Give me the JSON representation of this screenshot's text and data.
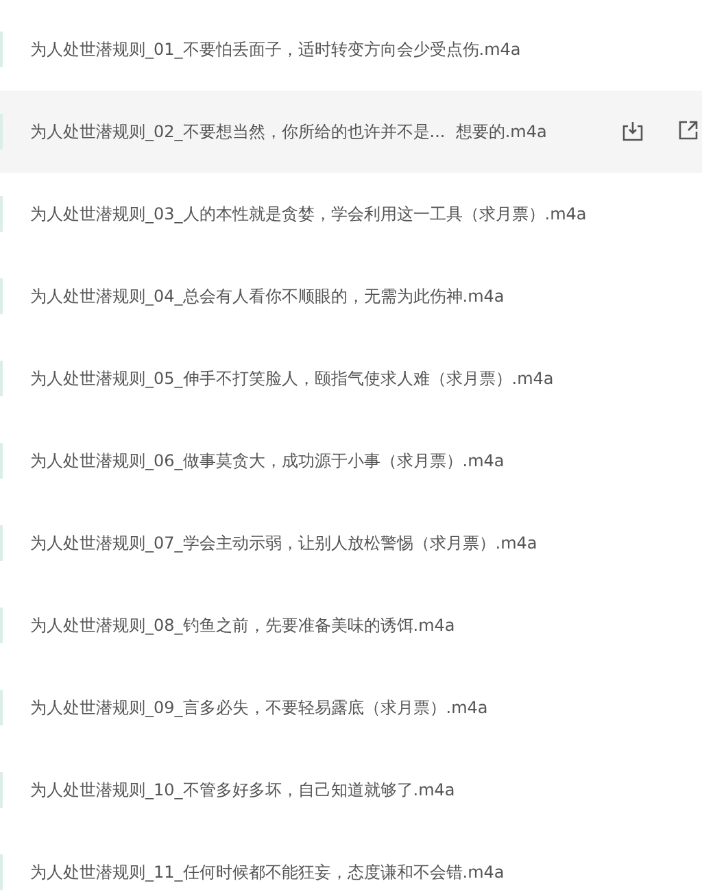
{
  "files": [
    {
      "name": "为人处世潜规则_01_不要怕丢面子，适时转变方向会少受点伤.m4a",
      "highlighted": false
    },
    {
      "name": "为人处世潜规则_02_不要想当然，你所给的也许并不是...  想要的.m4a",
      "highlighted": true
    },
    {
      "name": "为人处世潜规则_03_人的本性就是贪婪，学会利用这一工具（求月票）.m4a",
      "highlighted": false
    },
    {
      "name": "为人处世潜规则_04_总会有人看你不顺眼的，无需为此伤神.m4a",
      "highlighted": false
    },
    {
      "name": "为人处世潜规则_05_伸手不打笑脸人，颐指气使求人难（求月票）.m4a",
      "highlighted": false
    },
    {
      "name": "为人处世潜规则_06_做事莫贪大，成功源于小事（求月票）.m4a",
      "highlighted": false
    },
    {
      "name": "为人处世潜规则_07_学会主动示弱，让别人放松警惕（求月票）.m4a",
      "highlighted": false
    },
    {
      "name": "为人处世潜规则_08_钓鱼之前，先要准备美味的诱饵.m4a",
      "highlighted": false
    },
    {
      "name": "为人处世潜规则_09_言多必失，不要轻易露底（求月票）.m4a",
      "highlighted": false
    },
    {
      "name": "为人处世潜规则_10_不管多好多坏，自己知道就够了.m4a",
      "highlighted": false
    },
    {
      "name": "为人处世潜规则_11_任何时候都不能狂妄，态度谦和不会错.m4a",
      "highlighted": false
    }
  ]
}
